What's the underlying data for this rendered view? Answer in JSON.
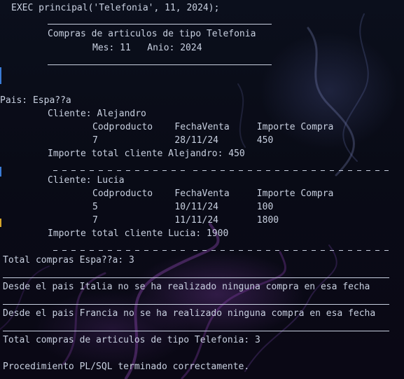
{
  "terminal": {
    "command": "EXEC principal('Telefonia', 11, 2024);",
    "header": {
      "title": "Compras de articulos de tipo Telefonia",
      "month_year": "Mes: 11   Anio: 2024"
    },
    "countries": [
      {
        "label": "Pais: Espa??a",
        "clients": [
          {
            "label": "Cliente: Alejandro",
            "columns": "Codproducto    FechaVenta     Importe Compra",
            "rows": [
              "7              28/11/24       450"
            ],
            "total": "Importe total cliente Alejandro: 450"
          },
          {
            "label": "Cliente: Lucia",
            "columns": "Codproducto    FechaVenta     Importe Compra",
            "rows": [
              "5              10/11/24       100",
              "7              11/11/24       1800"
            ],
            "total": "Importe total cliente Lucia: 1900"
          }
        ],
        "total": "Total compras Espa??a: 3"
      }
    ],
    "no_purchase_messages": [
      "Desde el pais Italia no se ha realizado ninguna compra en esa fecha",
      "Desde el pais Francia no se ha realizado ninguna compra en esa fecha"
    ],
    "grand_total": "Total compras de articulos de tipo Telefonia: 3",
    "completion_message": "Procedimiento PL/SQL terminado correctamente."
  },
  "colors": {
    "text": "#c8d0e0",
    "background": "#0a0d18"
  }
}
